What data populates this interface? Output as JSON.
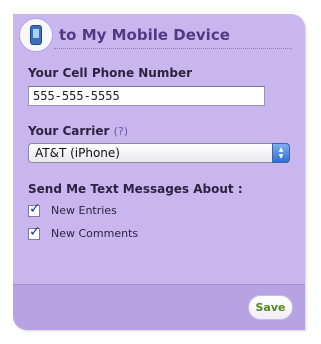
{
  "header": {
    "title": "to My Mobile Device",
    "icon": "mobile-phone-icon"
  },
  "phone_field": {
    "label": "Your Cell Phone Number",
    "value": "555-555-5555"
  },
  "carrier_field": {
    "label": "Your Carrier",
    "help": "(?)",
    "selected": "AT&T (iPhone)"
  },
  "notifications": {
    "label": "Send Me Text Messages About :",
    "options": [
      {
        "label": "New Entries",
        "checked": true
      },
      {
        "label": "New Comments",
        "checked": true
      }
    ]
  },
  "footer": {
    "save_label": "Save"
  },
  "colors": {
    "panel": "#c9b6ee",
    "footer": "#b7a2e3",
    "title": "#503a84",
    "save_text": "#4f8a1f"
  }
}
